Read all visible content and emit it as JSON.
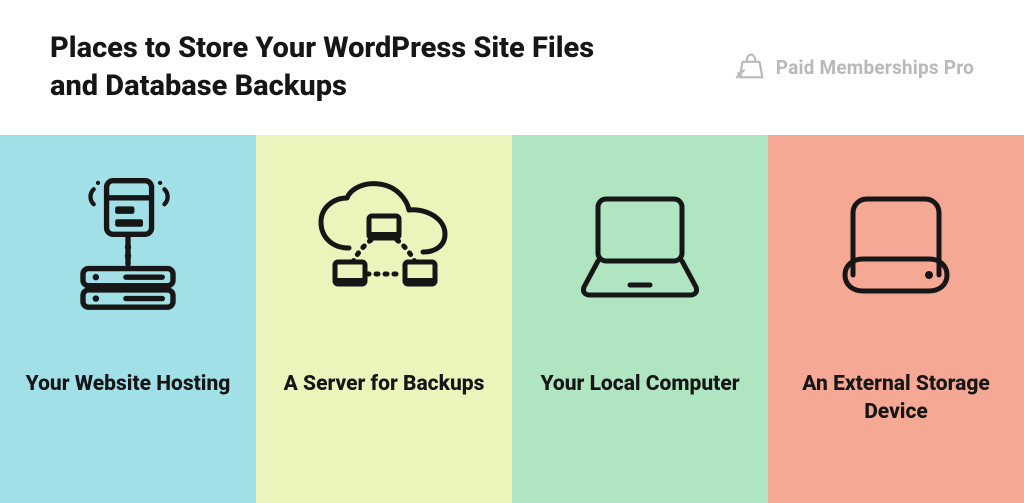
{
  "header": {
    "title": "Places to Store Your WordPress Site Files and Database Backups",
    "brand": "Paid Memberships Pro"
  },
  "cards": [
    {
      "icon": "hosting-icon",
      "label": "Your Website Hosting",
      "bgClass": "bg-a"
    },
    {
      "icon": "cloud-server-icon",
      "label": "A Server for Backups",
      "bgClass": "bg-b"
    },
    {
      "icon": "laptop-icon",
      "label": "Your Local Computer",
      "bgClass": "bg-c"
    },
    {
      "icon": "storage-device-icon",
      "label": "An External Storage Device",
      "bgClass": "bg-d"
    }
  ]
}
